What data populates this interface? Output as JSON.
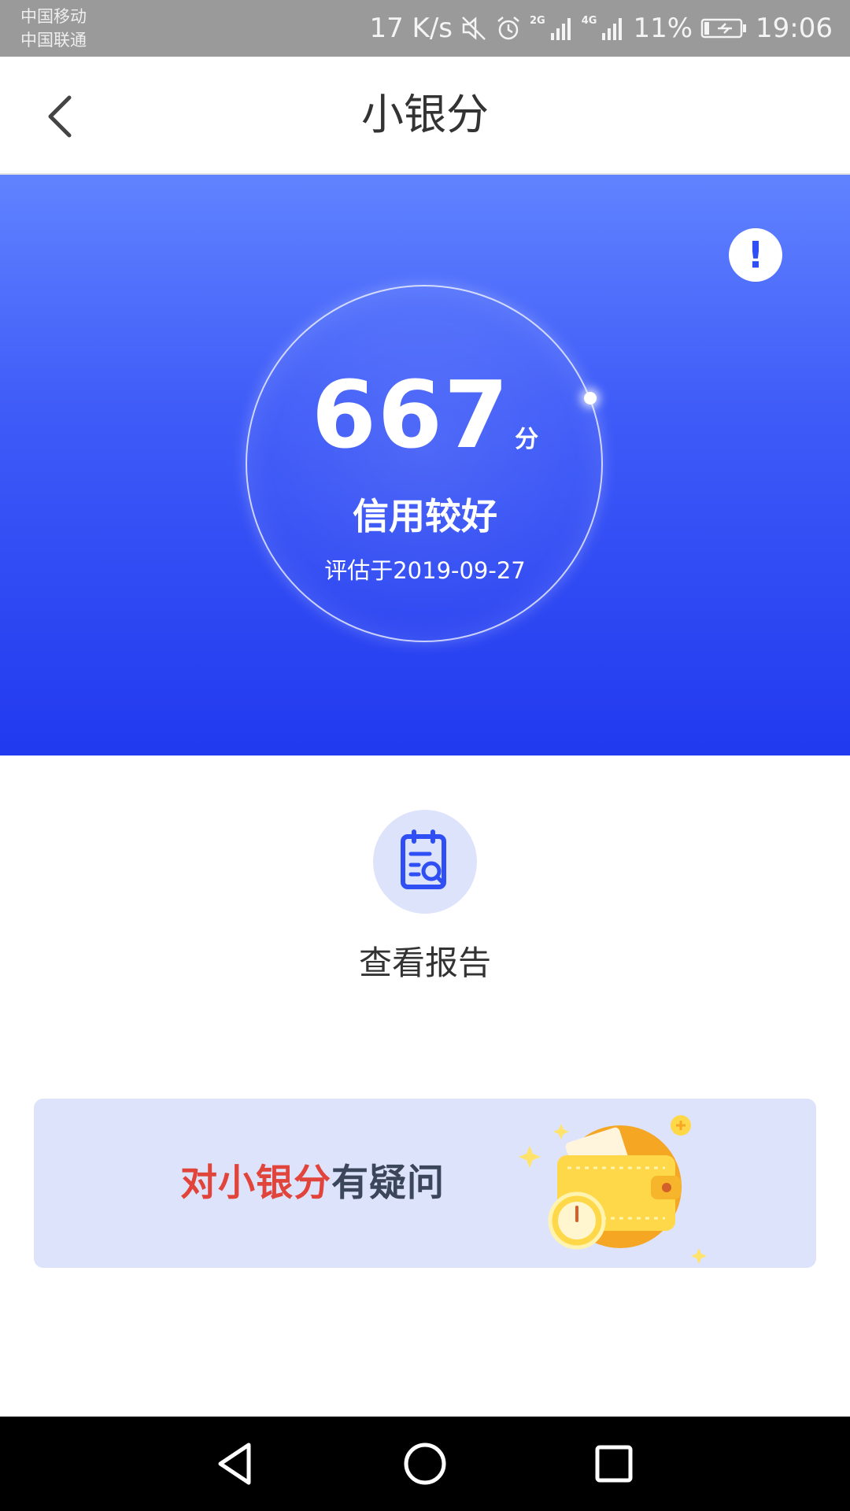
{
  "status_bar": {
    "carrier_1": "中国移动",
    "carrier_2": "中国联通",
    "net_speed": "17 K/s",
    "sim1_type": "2G",
    "sim2_type": "4G",
    "battery": "11%",
    "time": "19:06",
    "icons": [
      "mute-icon",
      "alarm-icon",
      "signal-icon",
      "battery-icon"
    ]
  },
  "header": {
    "title": "小银分",
    "back_icon": "chevron-left-icon"
  },
  "score_card": {
    "info_label": "!",
    "score": "667",
    "unit": "分",
    "level": "信用较好",
    "evaluated_on": "评估于2019-09-27",
    "gradient_top": "#6183ff",
    "gradient_bottom": "#2139ef"
  },
  "report": {
    "icon": "report-search-icon",
    "label": "查看报告"
  },
  "banner": {
    "highlight": "对小银分",
    "rest": "有疑问",
    "highlight_color": "#e1443a",
    "illustration": "wallet-clock-illustration"
  },
  "nav_bar": {
    "buttons": [
      "back-triangle-icon",
      "home-circle-icon",
      "recents-square-icon"
    ]
  }
}
